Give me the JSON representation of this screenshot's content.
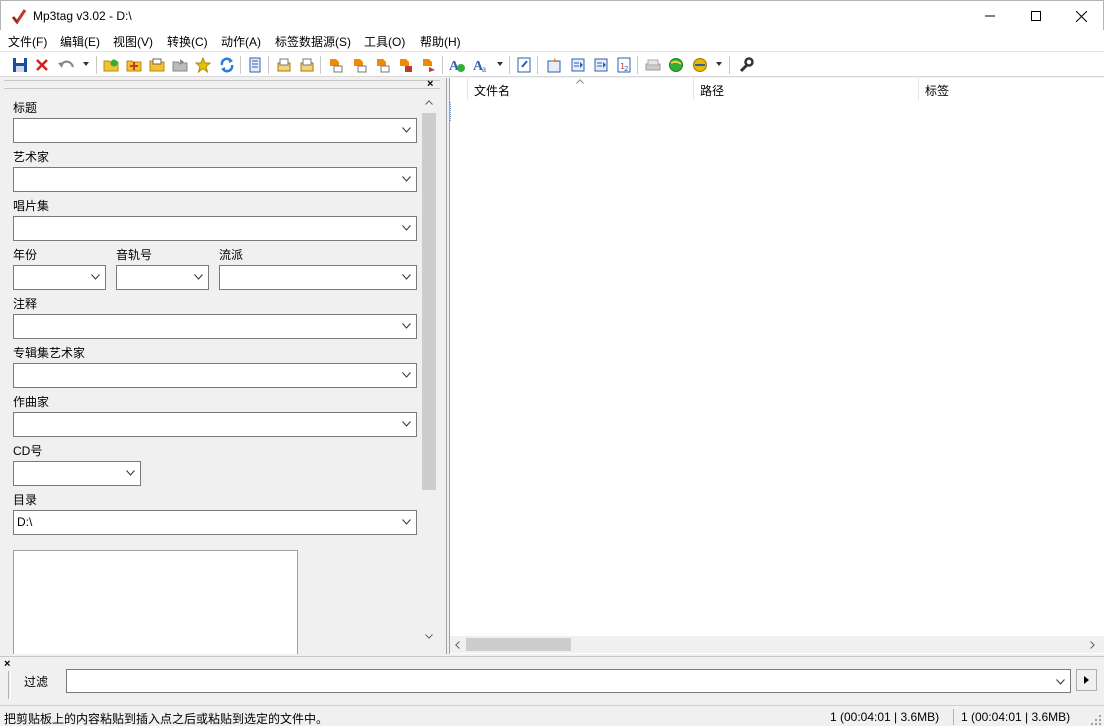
{
  "window": {
    "title": "Mp3tag v3.02  -  D:\\",
    "controls": [
      "minimize",
      "maximize",
      "close"
    ]
  },
  "menu": [
    {
      "label": "文件(F)"
    },
    {
      "label": "编辑(E)"
    },
    {
      "label": "视图(V)"
    },
    {
      "label": "转换(C)"
    },
    {
      "label": "动作(A)"
    },
    {
      "label": "标签数据源(S)"
    },
    {
      "label": "工具(O)"
    },
    {
      "label": "帮助(H)"
    }
  ],
  "toolbar": {
    "icons": [
      "save-icon",
      "remove-tag-icon",
      "undo-icon",
      "change-directory-icon",
      "add-directory-icon",
      "open-playlist-icon",
      "export-icon",
      "favorite-icon",
      "refresh-icon",
      "options-icon",
      "cut-tag-icon",
      "copy-tag-icon",
      "tag-to-filename-icon",
      "filename-to-tag-icon",
      "filename-to-filename-icon",
      "text-file-to-tag-icon",
      "tag-to-tag-icon",
      "autonumber-icon",
      "case-conversion-icon",
      "extended-tags-icon",
      "create-playlist-icon",
      "export-html-icon",
      "export-csv-icon",
      "numbering-wizard-icon",
      "freedb-icon",
      "web-source-icon",
      "tag-sources-icon",
      "tools-wrench-icon"
    ],
    "colors": {
      "save": "#1b4f9c",
      "remove": "#d32020",
      "folder": "#f2c12e",
      "star": "#e6c200",
      "refresh": "#2d7bd6",
      "action": "#f08a00"
    }
  },
  "tag_panel": {
    "fields": [
      {
        "label": "标题",
        "value": ""
      },
      {
        "label": "艺术家",
        "value": ""
      },
      {
        "label": "唱片集",
        "value": ""
      },
      {
        "label": "年份",
        "value": ""
      },
      {
        "label": "音轨号",
        "value": ""
      },
      {
        "label": "流派",
        "value": ""
      },
      {
        "label": "注释",
        "value": ""
      },
      {
        "label": "专辑集艺术家",
        "value": ""
      },
      {
        "label": "作曲家",
        "value": ""
      },
      {
        "label": "CD号",
        "value": ""
      },
      {
        "label": "目录",
        "value": "D:\\"
      }
    ]
  },
  "file_list": {
    "columns": [
      {
        "label": "文件名",
        "sorted": true
      },
      {
        "label": "路径"
      },
      {
        "label": "标签"
      }
    ],
    "rows": []
  },
  "filter": {
    "label": "过滤",
    "value": ""
  },
  "status": {
    "message": "把剪贴板上的内容粘贴到插入点之后或粘贴到选定的文件中。",
    "selected": "1 (00:04:01 | 3.6MB)",
    "total": "1 (00:04:01 | 3.6MB)"
  }
}
